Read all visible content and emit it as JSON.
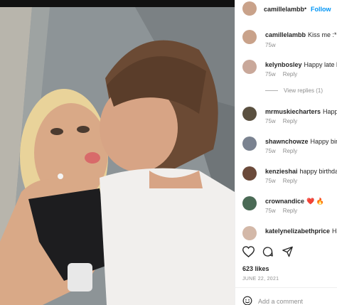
{
  "post": {
    "username": "camillelambb",
    "dot": "•",
    "follow": "Follow"
  },
  "caption": {
    "username": "camillelambb",
    "text": "Kiss me :* i",
    "time": "75w"
  },
  "comments": [
    {
      "username": "kelynbosley",
      "text": "Happy late b",
      "time": "75w",
      "reply": "Reply",
      "avatar_color": "#c9a89a"
    },
    {
      "username": "mrmuskiecharters",
      "text": "Happ",
      "time": "75w",
      "reply": "Reply",
      "avatar_color": "#5a5040"
    },
    {
      "username": "shawnchowze",
      "text": "Happy birt",
      "time": "75w",
      "reply": "Reply",
      "avatar_color": "#7a8290"
    },
    {
      "username": "kenzieshai",
      "text": "happy birthda",
      "time": "75w",
      "reply": "Reply",
      "avatar_color": "#6b4a3a"
    },
    {
      "username": "crownandice",
      "text": "❤️ 🔥",
      "time": "75w",
      "reply": "Reply",
      "avatar_color": "#4a6a55"
    },
    {
      "username": "katelynelizabethprice",
      "text": "Ha",
      "time": "",
      "reply": "",
      "avatar_color": "#d3b8a8"
    }
  ],
  "view_replies": "View replies (1)",
  "actions": {
    "like": "heart-icon",
    "comment": "comment-icon",
    "share": "share-icon"
  },
  "likes": "623 likes",
  "date": "JUNE 22, 2021",
  "add_comment": {
    "placeholder": "Add a comment",
    "icon": "smiley-icon"
  },
  "colors": {
    "follow": "#0095f6",
    "muted": "#8e8e8e"
  }
}
